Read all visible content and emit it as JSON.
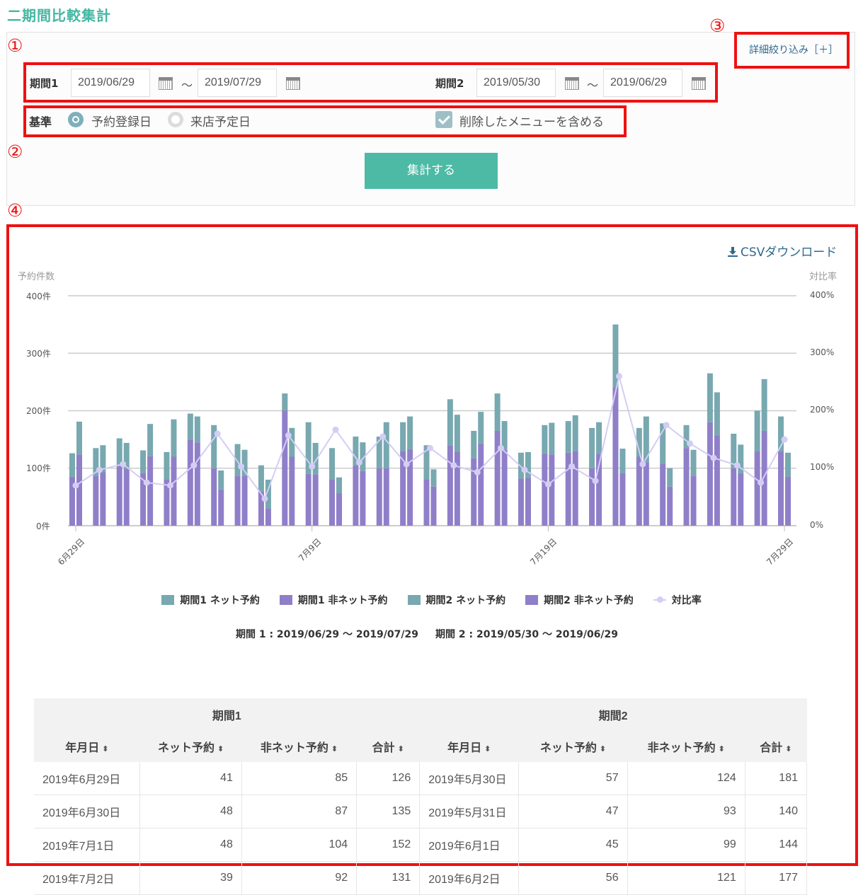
{
  "page_title": "二期間比較集計",
  "markers": [
    "①",
    "②",
    "③",
    "④"
  ],
  "filter": {
    "period1_label": "期間1",
    "period1_start": "2019/06/29",
    "period1_end": "2019/07/29",
    "period2_label": "期間2",
    "period2_start": "2019/05/30",
    "period2_end": "2019/06/29",
    "tilde": "～",
    "basis_label": "基準",
    "basis_options": [
      "予約登録日",
      "来店予定日"
    ],
    "basis_selected": "予約登録日",
    "include_deleted_label": "削除したメニューを含める",
    "include_deleted_checked": true,
    "submit_label": "集計する",
    "detail_link": "詳細絞り込み［＋］"
  },
  "csv_label": "CSVダウンロード",
  "chart_data": {
    "type": "bar",
    "y_left_title": "予約件数",
    "y_right_title": "対比率",
    "y_left_ticks": [
      "400件",
      "300件",
      "200件",
      "100件",
      "0件"
    ],
    "y_right_ticks": [
      "400%",
      "300%",
      "200%",
      "100%",
      "0%"
    ],
    "ylim_left": [
      0,
      400
    ],
    "ylim_right": [
      0,
      400
    ],
    "x_tick_labels": [
      "6月29日",
      "7月9日",
      "7月19日",
      "7月29日"
    ],
    "x_tick_indices": [
      0,
      10,
      20,
      30
    ],
    "legend": [
      "期間1 ネット予約",
      "期間1 非ネット予約",
      "期間2 ネット予約",
      "期間2 非ネット予約",
      "対比率"
    ],
    "colors": {
      "net": "#78a8b0",
      "non_net": "#8f7fc9",
      "ratio": "#d4cdf5",
      "grid": "#cccccc"
    },
    "period1_net": [
      41,
      48,
      48,
      39,
      48,
      45,
      75,
      55,
      45,
      30,
      90,
      55,
      50,
      55,
      50,
      60,
      80,
      48,
      65,
      45,
      50,
      55,
      70,
      110,
      50,
      70,
      40,
      85,
      60,
      70,
      60
    ],
    "period1_non_net": [
      85,
      87,
      104,
      92,
      80,
      150,
      100,
      87,
      60,
      200,
      90,
      80,
      105,
      100,
      130,
      80,
      140,
      117,
      165,
      82,
      125,
      127,
      100,
      240,
      120,
      108,
      135,
      180,
      100,
      130,
      130
    ],
    "period2_net": [
      57,
      47,
      45,
      56,
      65,
      45,
      33,
      45,
      50,
      50,
      55,
      28,
      50,
      80,
      57,
      30,
      65,
      55,
      50,
      45,
      55,
      62,
      55,
      42,
      80,
      32,
      45,
      75,
      50,
      90,
      42
    ],
    "period2_non_net": [
      124,
      93,
      99,
      121,
      120,
      145,
      63,
      87,
      30,
      120,
      89,
      56,
      95,
      100,
      133,
      68,
      128,
      143,
      132,
      83,
      124,
      130,
      125,
      92,
      110,
      68,
      87,
      157,
      91,
      165,
      85
    ],
    "ratio": [
      70,
      97,
      107,
      75,
      70,
      105,
      160,
      103,
      47,
      157,
      103,
      167,
      110,
      155,
      107,
      135,
      105,
      93,
      135,
      97,
      72,
      103,
      78,
      260,
      107,
      175,
      143,
      118,
      105,
      75,
      150
    ],
    "x_count": 31
  },
  "summary": {
    "period1": "期間 1 : 2019/06/29 ～ 2019/07/29",
    "period2": "期間 2 : 2019/05/30 ～ 2019/06/29"
  },
  "table": {
    "group_headers": [
      "期間1",
      "期間2"
    ],
    "columns": [
      "年月日",
      "ネット予約",
      "非ネット予約",
      "合計",
      "年月日",
      "ネット予約",
      "非ネット予約",
      "合計"
    ],
    "sort_icon": "⬍",
    "rows": [
      [
        "2019年6月29日",
        "41",
        "85",
        "126",
        "2019年5月30日",
        "57",
        "124",
        "181"
      ],
      [
        "2019年6月30日",
        "48",
        "87",
        "135",
        "2019年5月31日",
        "47",
        "93",
        "140"
      ],
      [
        "2019年7月1日",
        "48",
        "104",
        "152",
        "2019年6月1日",
        "45",
        "99",
        "144"
      ],
      [
        "2019年7月2日",
        "39",
        "92",
        "131",
        "2019年6月2日",
        "56",
        "121",
        "177"
      ]
    ]
  }
}
